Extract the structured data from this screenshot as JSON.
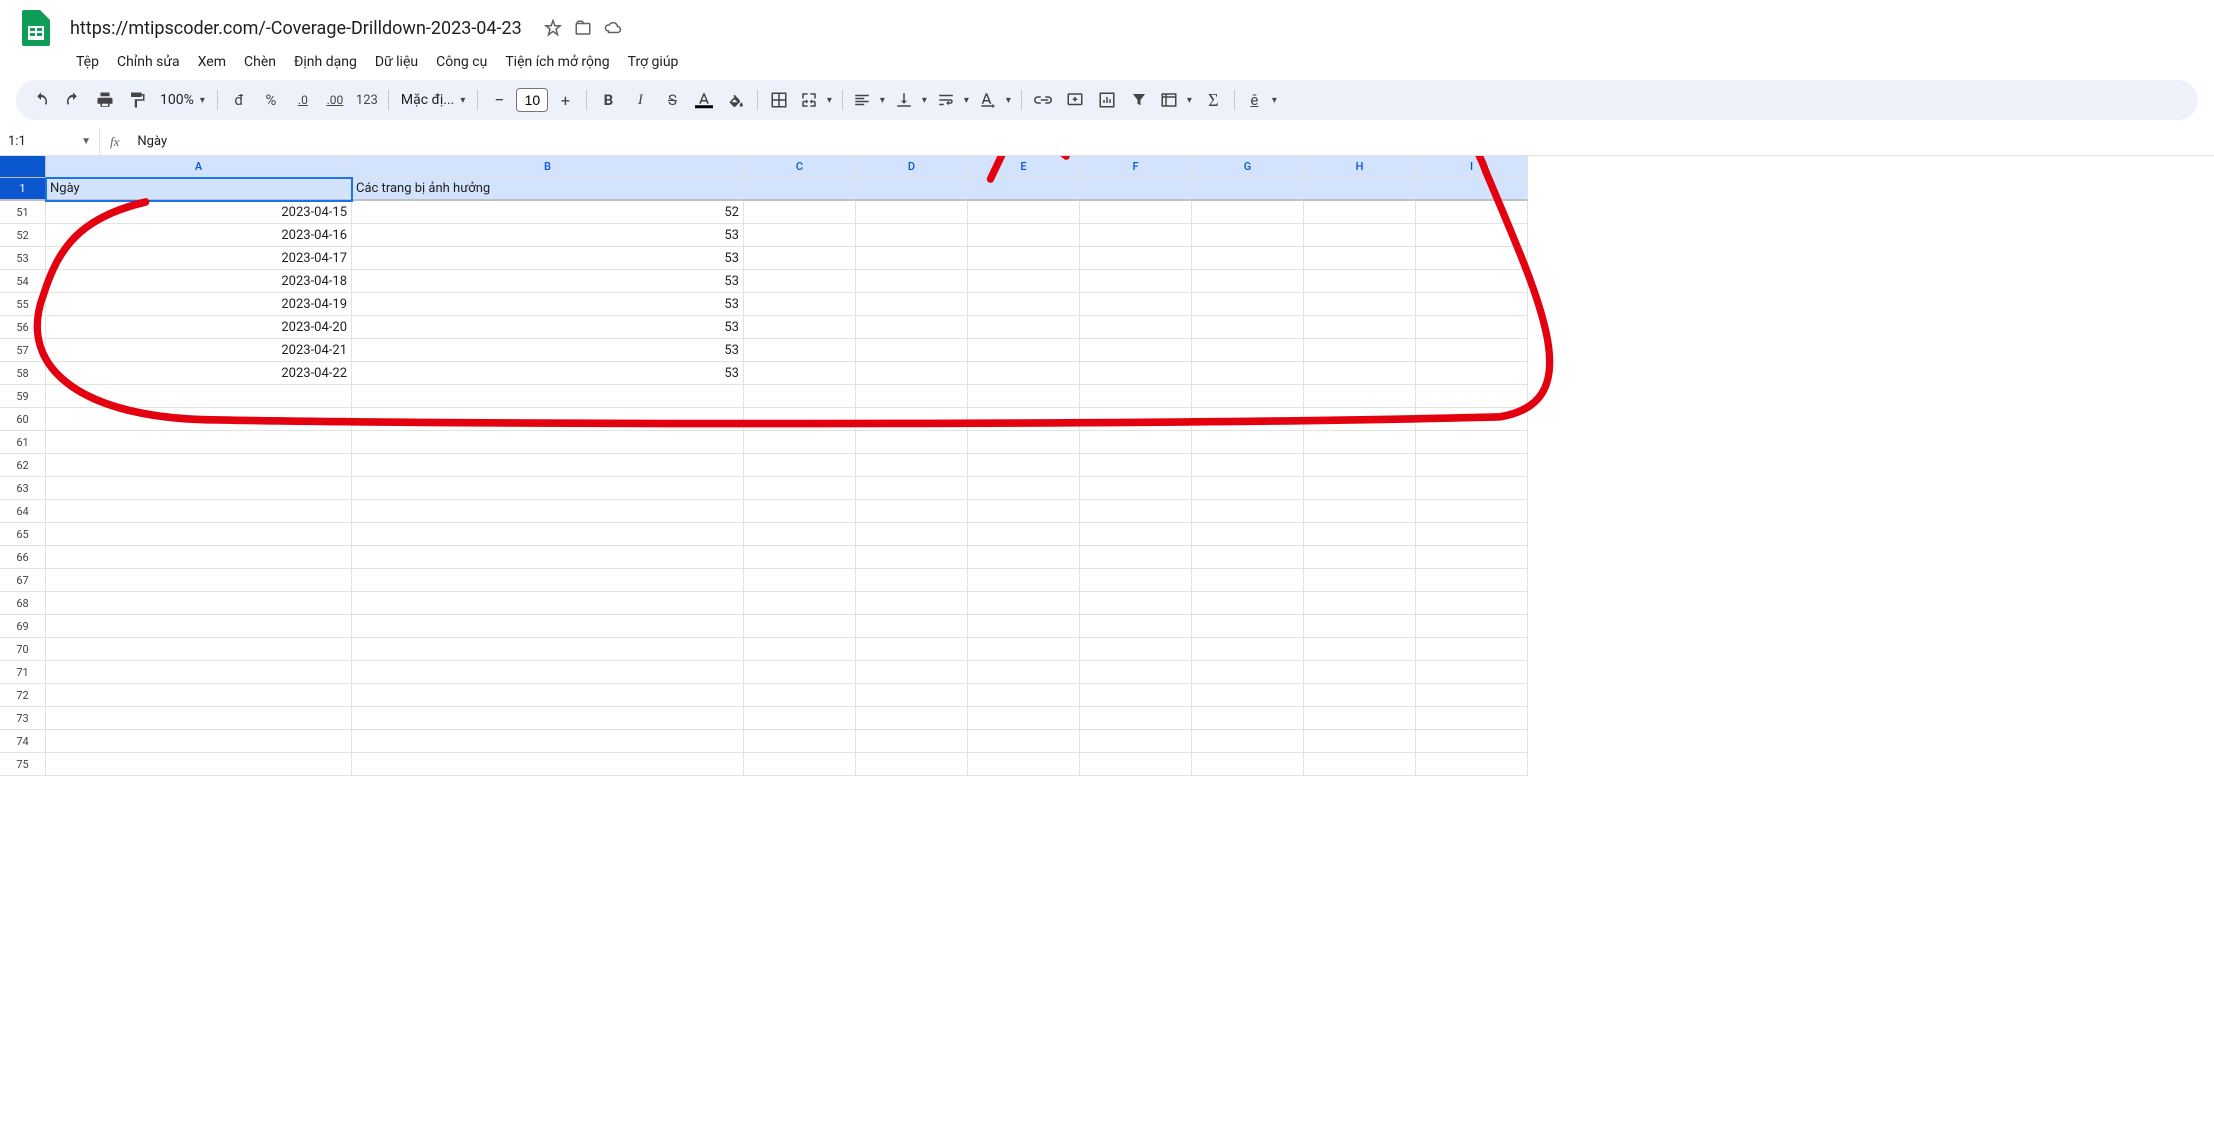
{
  "doc": {
    "title": "https://mtipscoder.com/-Coverage-Drilldown-2023-04-23"
  },
  "menus": [
    "Tệp",
    "Chỉnh sửa",
    "Xem",
    "Chèn",
    "Định dạng",
    "Dữ liệu",
    "Công cụ",
    "Tiện ích mở rộng",
    "Trợ giúp"
  ],
  "toolbar": {
    "zoom": "100%",
    "currency": "đ",
    "percent": "%",
    "dec_dec": ".0",
    "inc_dec": ".00",
    "more_fmt": "123",
    "font": "Mặc đị...",
    "font_size": "10",
    "minus": "−",
    "plus": "+"
  },
  "name_box": "1:1",
  "formula": "Ngày",
  "columns": [
    "A",
    "B",
    "C",
    "D",
    "E",
    "F",
    "G",
    "H",
    "I"
  ],
  "header_row": {
    "a": "Ngày",
    "b": "Các trang bị ảnh hưởng"
  },
  "rows": [
    {
      "num": 51,
      "a": "2023-04-15",
      "b": "52"
    },
    {
      "num": 52,
      "a": "2023-04-16",
      "b": "53"
    },
    {
      "num": 53,
      "a": "2023-04-17",
      "b": "53"
    },
    {
      "num": 54,
      "a": "2023-04-18",
      "b": "53"
    },
    {
      "num": 55,
      "a": "2023-04-19",
      "b": "53"
    },
    {
      "num": 56,
      "a": "2023-04-20",
      "b": "53"
    },
    {
      "num": 57,
      "a": "2023-04-21",
      "b": "53"
    },
    {
      "num": 58,
      "a": "2023-04-22",
      "b": "53"
    }
  ],
  "empty_rows": [
    59,
    60,
    61,
    62,
    63,
    64,
    65,
    66,
    67,
    68,
    69,
    70,
    71,
    72,
    73,
    74,
    75
  ]
}
